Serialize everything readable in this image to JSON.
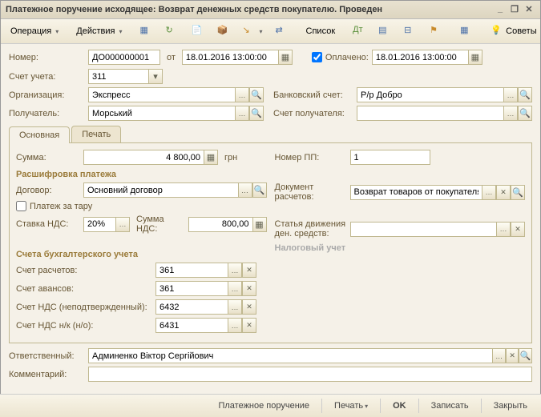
{
  "window": {
    "title": "Платежное поручение исходящее: Возврат денежных средств покупателю. Проведен"
  },
  "toolbar": {
    "operation": "Операция",
    "actions": "Действия",
    "list": "Список",
    "advice": "Советы"
  },
  "fields": {
    "number_lbl": "Номер:",
    "number": "ДО000000001",
    "from": "от",
    "date": "18.01.2016 13:00:00",
    "paid_lbl": "Оплачено:",
    "paid_date": "18.01.2016 13:00:00",
    "account_lbl": "Счет учета:",
    "account": "311",
    "org_lbl": "Организация:",
    "org": "Экспресс",
    "bank_lbl": "Банковский счет:",
    "bank": "Р/р Добро",
    "recipient_lbl": "Получатель:",
    "recipient": "Морський",
    "rec_account_lbl": "Счет получателя:",
    "rec_account": ""
  },
  "tabs": {
    "main": "Основная",
    "print": "Печать"
  },
  "main": {
    "sum_lbl": "Сумма:",
    "sum": "4 800,00",
    "sum_cur": "грн",
    "pp_lbl": "Номер ПП:",
    "pp": "1",
    "decode_title": "Расшифровка платежа",
    "contract_lbl": "Договор:",
    "contract": "Основний договор",
    "doc_calc_lbl": "Документ расчетов:",
    "doc_calc": "Возврат товаров от покупателя",
    "tare_lbl": "Платеж за тару",
    "vat_rate_lbl": "Ставка НДС:",
    "vat_rate": "20%",
    "vat_sum_lbl": "Сумма НДС:",
    "vat_sum": "800,00",
    "cashflow_lbl": "Статья движения ден. средств:",
    "cashflow": "",
    "tax_title": "Налоговый учет",
    "acc_title": "Счета бухгалтерского учета",
    "acc_calc_lbl": "Счет расчетов:",
    "acc_calc": "361",
    "acc_adv_lbl": "Счет авансов:",
    "acc_adv": "361",
    "acc_vat_unconf_lbl": "Счет НДС (неподтвержденный):",
    "acc_vat_unconf": "6432",
    "acc_vat_nk_lbl": "Счет НДС н/к (н/о):",
    "acc_vat_nk": "6431"
  },
  "footer": {
    "resp_lbl": "Ответственный:",
    "resp": "Админенко Віктор Сергійович",
    "comment_lbl": "Комментарий:",
    "comment": ""
  },
  "bottom": {
    "payorder": "Платежное поручение",
    "print": "Печать",
    "ok": "OK",
    "save": "Записать",
    "close": "Закрыть"
  }
}
